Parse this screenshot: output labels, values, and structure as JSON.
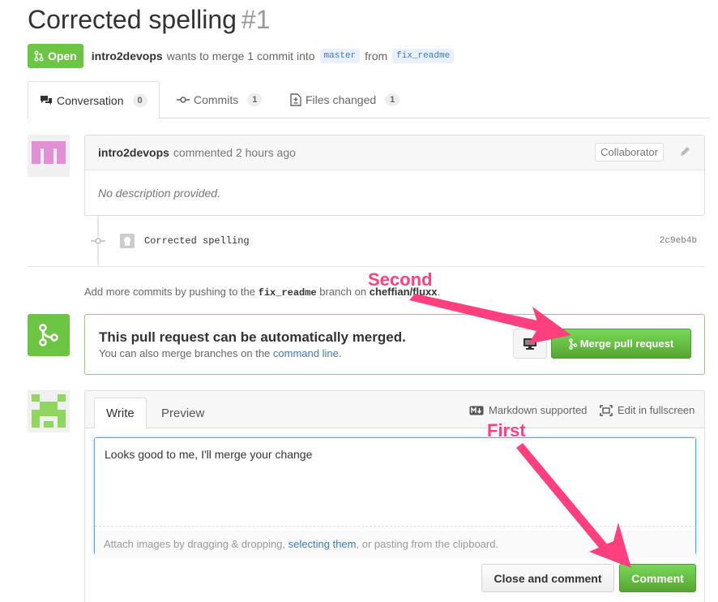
{
  "pr": {
    "title": "Corrected spelling",
    "number": "#1",
    "state_label": "Open",
    "author": "intro2devops",
    "merge_text": "wants to merge 1 commit into",
    "base_branch": "master",
    "from_text": "from",
    "head_branch": "fix_readme"
  },
  "tabs": [
    {
      "label": "Conversation",
      "count": "0"
    },
    {
      "label": "Commits",
      "count": "1"
    },
    {
      "label": "Files changed",
      "count": "1"
    }
  ],
  "comment": {
    "author": "intro2devops",
    "action": "commented 2 hours ago",
    "role_badge": "Collaborator",
    "body": "No description provided."
  },
  "commit": {
    "message": "Corrected spelling",
    "sha": "2c9eb4b"
  },
  "push_hint": {
    "prefix": "Add more commits by pushing to the",
    "branch": "fix_readme",
    "middle": "branch on",
    "repo": "cheffian/fluxx",
    "suffix": "."
  },
  "merge": {
    "title": "This pull request can be automatically merged.",
    "subtitle_prefix": "You can also merge branches on the",
    "subtitle_link": "command line",
    "subtitle_suffix": ".",
    "button_label": "Merge pull request"
  },
  "form": {
    "write_tab": "Write",
    "preview_tab": "Preview",
    "markdown_note": "Markdown supported",
    "fullscreen_note": "Edit in fullscreen",
    "textarea_value": "Looks good to me, I'll merge your change",
    "drop_prefix": "Attach images by dragging & dropping,",
    "drop_link": "selecting them",
    "drop_suffix": ", or pasting from the clipboard.",
    "close_button": "Close and comment",
    "comment_button": "Comment"
  },
  "annotations": {
    "second": "Second",
    "first": "First"
  },
  "colors": {
    "green": "#6cc644",
    "accent_arrow": "#ff3f7e",
    "link": "#4078c0"
  }
}
